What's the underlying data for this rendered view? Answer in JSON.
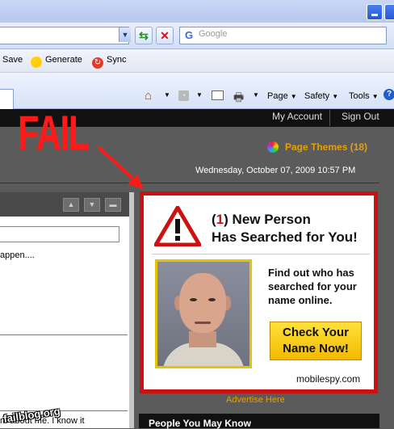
{
  "browser": {
    "search_placeholder": "Google",
    "toolbar": {
      "save": "Save",
      "generate": "Generate",
      "sync": "Sync"
    },
    "command_bar": {
      "page": "Page",
      "safety": "Safety",
      "tools": "Tools"
    }
  },
  "site": {
    "nav": {
      "my_account": "My Account",
      "sign_out": "Sign Out"
    },
    "page_themes": "Page Themes (18)",
    "date": "Wednesday, October 07, 2009 10:57 PM"
  },
  "left_panel": {
    "text1": "appen....",
    "text2": "m about me. I know it"
  },
  "ad": {
    "count": "1",
    "line1_rest": " New Person",
    "line2": "Has Searched for You!",
    "body": "Find out who has searched for your name online.",
    "cta": "Check Your Name Now!",
    "domain": "mobilespy.com",
    "advertise": "Advertise Here"
  },
  "people_you_may_know": "People You May Know",
  "overlay": {
    "fail": "FAIL",
    "watermark": "failblog.org"
  },
  "colors": {
    "fail_red": "#ff1a1a",
    "ad_border": "#cc1111",
    "theme_orange": "#e8a000",
    "cta_yellow": "#ffd21a"
  }
}
